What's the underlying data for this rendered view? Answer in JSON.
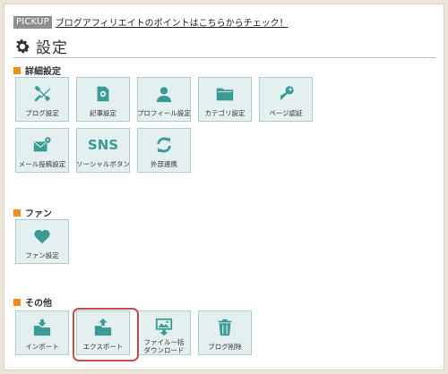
{
  "pickup": {
    "badge": "PICKUP",
    "link": "ブログアフィリエイトのポイントはこちらからチェック！"
  },
  "page": {
    "title": "設定"
  },
  "sections": {
    "details": {
      "heading": "詳細設定",
      "tiles": [
        {
          "label": "ブログ設定",
          "icon": "tools-icon"
        },
        {
          "label": "記事設定",
          "icon": "article-settings-icon"
        },
        {
          "label": "プロフィール設定",
          "icon": "person-icon"
        },
        {
          "label": "カテゴリ設定",
          "icon": "folder-icon"
        },
        {
          "label": "ページ認証",
          "icon": "key-icon"
        },
        {
          "label": "メール投稿設定",
          "icon": "mail-gear-icon"
        },
        {
          "label": "ソーシャルボタン",
          "icon": "sns-icon",
          "icon_text": "SNS"
        },
        {
          "label": "外部連携",
          "icon": "sync-icon"
        }
      ]
    },
    "fan": {
      "heading": "ファン",
      "tiles": [
        {
          "label": "ファン設定",
          "icon": "heart-icon"
        }
      ]
    },
    "other": {
      "heading": "その他",
      "tiles": [
        {
          "label": "インポート",
          "icon": "folder-import-icon"
        },
        {
          "label": "エクスポート",
          "icon": "folder-export-icon"
        },
        {
          "label_line1": "ファイル一括",
          "label_line2": "ダウンロード",
          "icon": "image-download-icon"
        },
        {
          "label": "ブログ削除",
          "icon": "trash-icon"
        }
      ]
    }
  },
  "colors": {
    "tile_bg": "#e3f0ef",
    "tile_border": "#a9cfcc",
    "icon": "#3a9a94",
    "section_marker": "#f08c18",
    "highlight": "#c84b50"
  }
}
